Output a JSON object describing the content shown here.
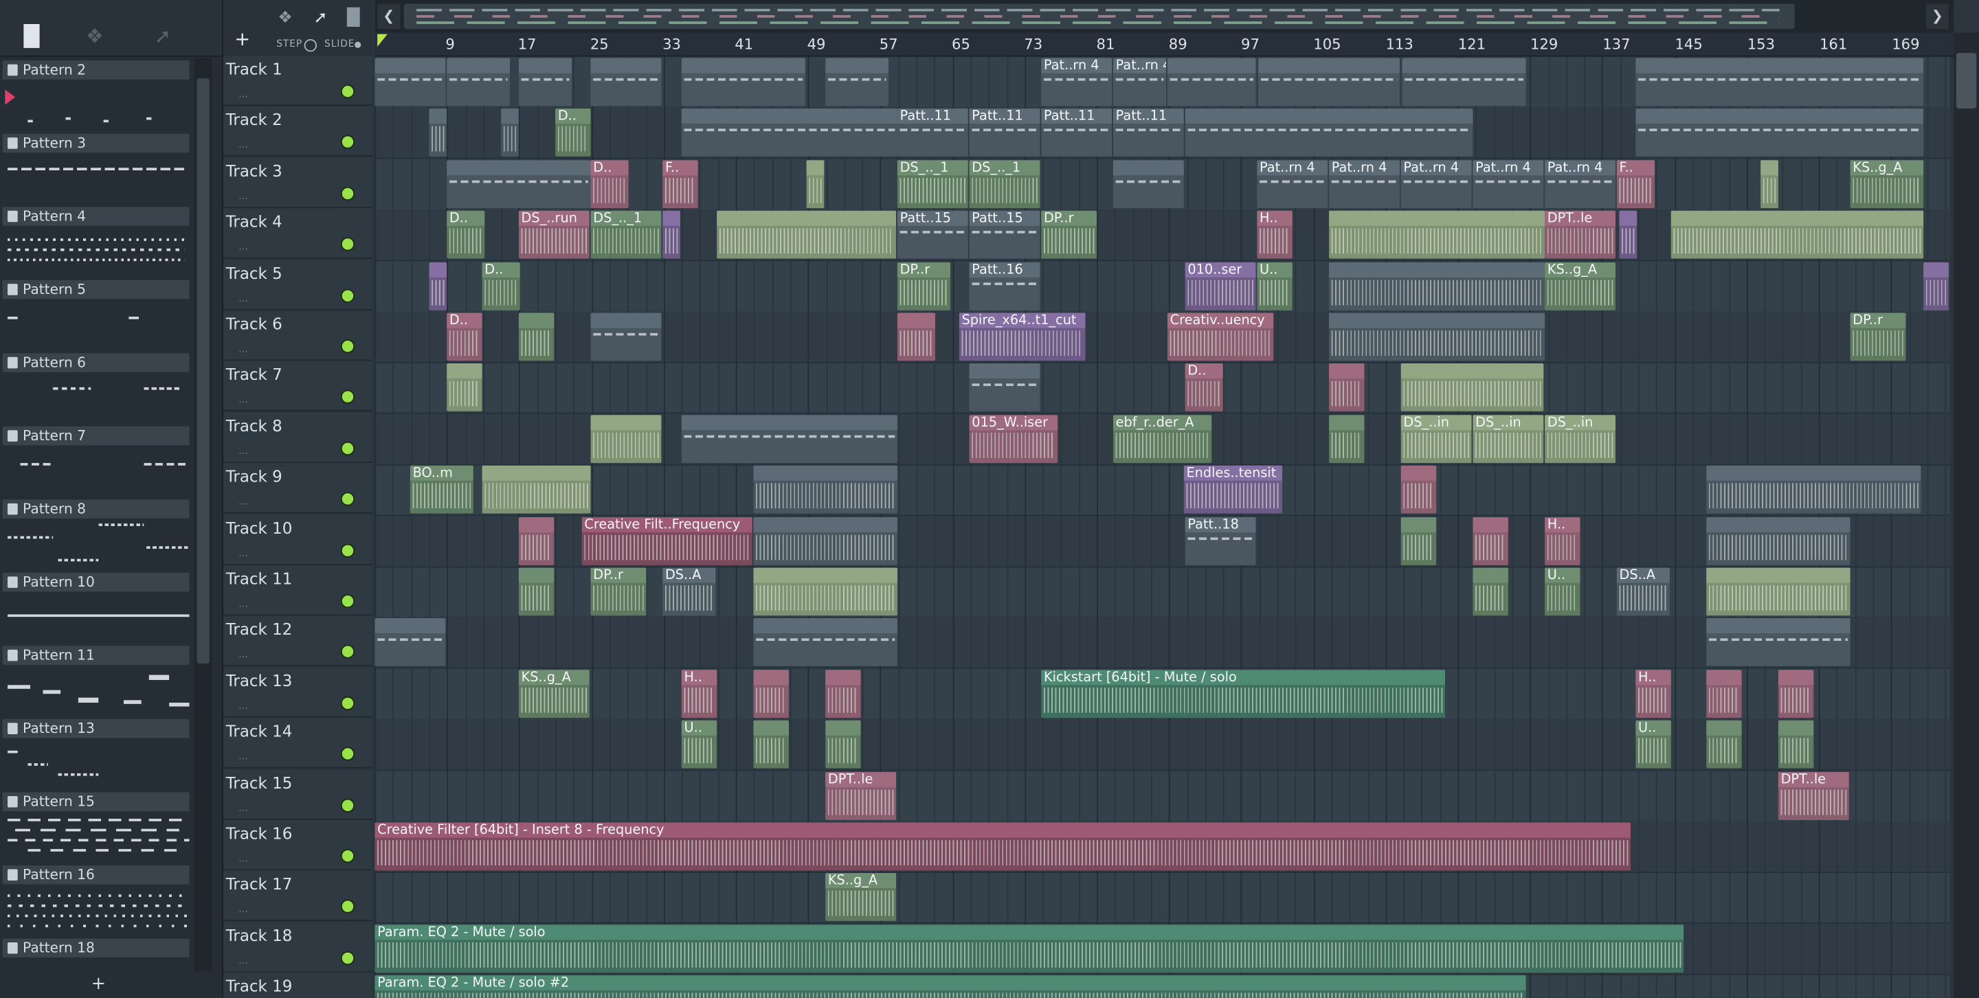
{
  "picker": {
    "top_icons": [
      "piano-icon",
      "wave-icon",
      "automation-icon"
    ],
    "patterns": [
      {
        "name": "Pattern 2"
      },
      {
        "name": "Pattern 3"
      },
      {
        "name": "Pattern 4"
      },
      {
        "name": "Pattern 5"
      },
      {
        "name": "Pattern 6"
      },
      {
        "name": "Pattern 7"
      },
      {
        "name": "Pattern 8"
      },
      {
        "name": "Pattern 10"
      },
      {
        "name": "Pattern 11"
      },
      {
        "name": "Pattern 13"
      },
      {
        "name": "Pattern 15"
      },
      {
        "name": "Pattern 16"
      },
      {
        "name": "Pattern 18"
      }
    ],
    "add_label": "+"
  },
  "toolbar": {
    "add_label": "+",
    "step_label": "STEP",
    "slide_label": "SLIDE"
  },
  "ruler": {
    "bars": [
      "9",
      "17",
      "25",
      "33",
      "41",
      "49",
      "57",
      "65",
      "73",
      "81",
      "89",
      "97",
      "105",
      "113",
      "121",
      "129",
      "137",
      "145",
      "153",
      "161",
      "169"
    ]
  },
  "tracks": [
    {
      "name": "Track 1"
    },
    {
      "name": "Track 2"
    },
    {
      "name": "Track 3"
    },
    {
      "name": "Track 4"
    },
    {
      "name": "Track 5"
    },
    {
      "name": "Track 6"
    },
    {
      "name": "Track 7"
    },
    {
      "name": "Track 8"
    },
    {
      "name": "Track 9"
    },
    {
      "name": "Track 10"
    },
    {
      "name": "Track 11"
    },
    {
      "name": "Track 12"
    },
    {
      "name": "Track 13"
    },
    {
      "name": "Track 14"
    },
    {
      "name": "Track 15"
    },
    {
      "name": "Track 16"
    },
    {
      "name": "Track 17"
    },
    {
      "name": "Track 18"
    },
    {
      "name": "Track 19"
    }
  ],
  "clips": {
    "t1_a": "Pat..rn 4",
    "t1_b": "Pat..rn 4",
    "t2_a": "D..",
    "t2_b": "Patt..11",
    "t2_c": "Patt..11",
    "t2_d": "Patt..11",
    "t2_e": "Patt..11",
    "t3_a": "D..",
    "t3_b": "F..",
    "t3_c": "DS_.._1",
    "t3_d": "DS_.._1",
    "t3_e": "Pat..rn 4",
    "t3_f": "Pat..rn 4",
    "t3_g": "Pat..rn 4",
    "t3_h": "Pat..rn 4",
    "t3_i": "Pat..rn 4",
    "t3_j": "F..",
    "t3_k": "KS..g_A",
    "t4_a": "D..",
    "t4_b": "DS_..run",
    "t4_c": "DS_.._1",
    "t4_d": "Patt..15",
    "t4_e": "Patt..15",
    "t4_f": "DP..r",
    "t4_g": "H..",
    "t4_h": "DPT..le",
    "t5_a": "D..",
    "t5_b": "DP..r",
    "t5_c": "Patt..16",
    "t5_d": "010..ser",
    "t5_e": "U..",
    "t5_f": "KS..g_A",
    "t6_a": "D..",
    "t6_b": "Spire_x64..t1_cut",
    "t6_c": "Creativ..uency",
    "t6_d": "DP..r",
    "t7_a": "D..",
    "t8_a": "015_W..iser",
    "t8_b": "ebf_r..der_A",
    "t8_c": "DS_..in",
    "t8_d": "DS_..in",
    "t8_e": "DS_..in",
    "t9_a": "BO..m",
    "t9_b": "Endles..tensit",
    "t10_a": "Creative Filt..Frequency",
    "t10_b": "Patt..18",
    "t10_c": "H..",
    "t11_a": "DP..r",
    "t11_b": "DS..A",
    "t11_c": "U..",
    "t11_d": "DS..A",
    "t13_a": "KS..g_A",
    "t13_b": "H..",
    "t13_c": "Kickstart [64bit] - Mute / solo",
    "t13_d": "H..",
    "t14_a": "U..",
    "t14_b": "U..",
    "t15_a": "DPT..le",
    "t15_b": "DPT..le",
    "t16_a": "Creative Filter [64bit] - Insert 8 - Frequency",
    "t17_a": "KS..g_A",
    "t18_a": "Param. EQ 2 - Mute / solo",
    "t19_a": "Param. EQ 2 - Mute / solo #2"
  }
}
